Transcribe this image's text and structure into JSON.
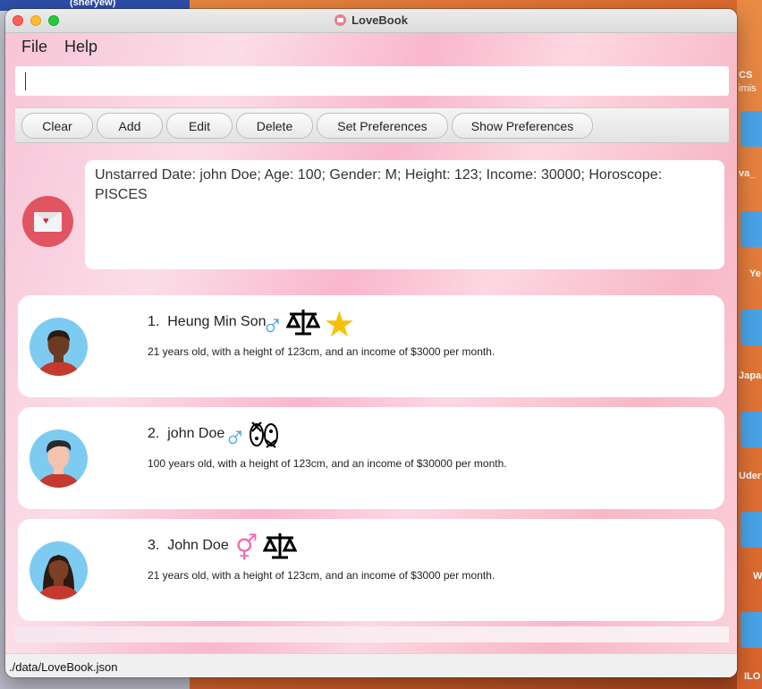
{
  "window": {
    "title": "LoveBook"
  },
  "menu": {
    "file": "File",
    "help": "Help"
  },
  "command_box": {
    "value": ""
  },
  "toolbar": {
    "clear": "Clear",
    "add": "Add",
    "edit": "Edit",
    "delete": "Delete",
    "set_preferences": "Set Preferences",
    "show_preferences": "Show Preferences"
  },
  "result": {
    "text": "Unstarred Date: john Doe; Age: 100; Gender: M; Height: 123; Income: 30000; Horoscope: PISCES"
  },
  "dates": [
    {
      "index": "1.",
      "name": "Heung Min Son",
      "gender": "male",
      "gender_symbol": "♂",
      "horoscope": "libra",
      "starred": true,
      "description": "21 years old, with a height of 123cm, and an income of $3000 per month.",
      "avatar_skin": "#6b3a22",
      "avatar_hair": "#2a1a12",
      "avatar_shirt": "#c53a2f"
    },
    {
      "index": "2.",
      "name": "john Doe",
      "gender": "male",
      "gender_symbol": "♂",
      "horoscope": "pisces",
      "starred": false,
      "description": "100 years old, with a height of 123cm, and an income of $30000 per month.",
      "avatar_skin": "#f3c3ae",
      "avatar_hair": "#2a2a2a",
      "avatar_shirt": "#c53a2f"
    },
    {
      "index": "3.",
      "name": "John Doe",
      "gender": "female",
      "gender_symbol": "⚥",
      "horoscope": "libra",
      "starred": false,
      "description": "21 years old, with a height of 123cm, and an income of $3000 per month.",
      "avatar_skin": "#7a4026",
      "avatar_hair": "#2a1a12",
      "avatar_shirt": "#c53a2f"
    }
  ],
  "status": {
    "file_path": "./data/LoveBook.json"
  },
  "desktop": {
    "top_user": "(sheryew)",
    "right_labels": [
      "CS",
      "imis",
      "va_",
      "Ye",
      "Japa",
      "Uder",
      "W",
      "ILO"
    ]
  },
  "colors": {
    "accent_blue": "#3fa3de",
    "accent_pink": "#ee6fb6",
    "star": "#f7c10b",
    "envelope_circle": "#e05561"
  }
}
